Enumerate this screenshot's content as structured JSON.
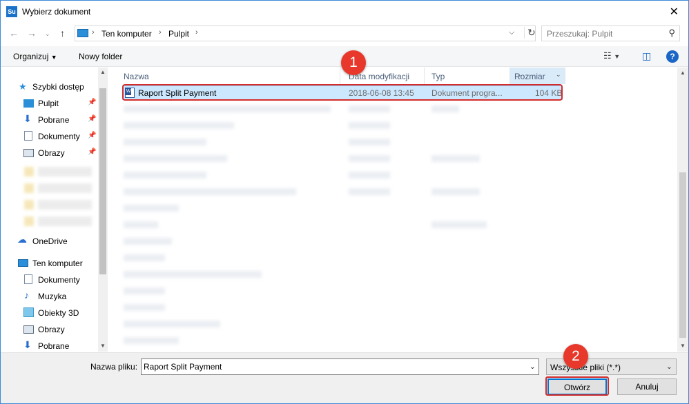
{
  "window": {
    "title": "Wybierz dokument",
    "app_icon_text": "Su"
  },
  "nav": {
    "breadcrumb": [
      "Ten komputer",
      "Pulpit"
    ],
    "search_placeholder": "Przeszukaj: Pulpit"
  },
  "toolbar": {
    "organize_label": "Organizuj",
    "new_folder_label": "Nowy folder"
  },
  "sidebar": {
    "quick_access": "Szybki dostęp",
    "quick_items": [
      {
        "label": "Pulpit",
        "icon": "desktop-icon"
      },
      {
        "label": "Pobrane",
        "icon": "download-icon"
      },
      {
        "label": "Dokumenty",
        "icon": "document-icon"
      },
      {
        "label": "Obrazy",
        "icon": "pictures-icon"
      }
    ],
    "onedrive": "OneDrive",
    "this_pc": "Ten komputer",
    "pc_items": [
      {
        "label": "Dokumenty",
        "icon": "document-icon"
      },
      {
        "label": "Muzyka",
        "icon": "music-icon"
      },
      {
        "label": "Obiekty 3D",
        "icon": "objects-3d-icon"
      },
      {
        "label": "Obrazy",
        "icon": "pictures-icon"
      },
      {
        "label": "Pobrane",
        "icon": "download-icon"
      }
    ]
  },
  "columns": {
    "name": "Nazwa",
    "date": "Data modyfikacji",
    "type": "Typ",
    "size": "Rozmiar"
  },
  "selected_file": {
    "name": "Raport Split Payment",
    "date": "2018-06-08 13:45",
    "type": "Dokument progra...",
    "size": "104 KB"
  },
  "footer": {
    "filename_label": "Nazwa pliku:",
    "filename_value": "Raport Split Payment",
    "filter_value": "Wszystkie pliki (*.*)",
    "open_label": "Otwórz",
    "cancel_label": "Anuluj"
  },
  "annotations": {
    "badge1": "1",
    "badge2": "2",
    "highlight_color": "#d42b2b"
  }
}
